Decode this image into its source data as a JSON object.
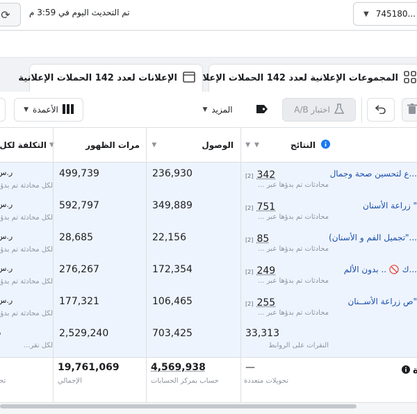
{
  "topbar": {
    "update_text": "تم التحديث اليوم في 3:59 م",
    "account_value": "745180..."
  },
  "tabs": {
    "adsets_label": "المجموعات الإعلانية لعدد 142 الحملات الإعلانية",
    "ads_label": "الإعلانات لعدد 142 الحملات الإعلانية"
  },
  "toolbar": {
    "ab_label": "اختبار A/B",
    "more_label": "المزيد",
    "columns_label": "الأعمدة"
  },
  "table": {
    "headers": {
      "results": "النتائج",
      "reach": "الوصول",
      "impressions": "مرات الظهور",
      "cost": "التكلفة لكل نتيجة"
    },
    "rows": [
      {
        "name": "...ع لتحسين صحة وجمال",
        "results": "342",
        "results_sub": "محادثات تم بدؤها عبر ...",
        "reach": "236,930",
        "impressions": "499,739",
        "cost": "ر.س",
        "cost_sub": "لكل محادثة تم بدؤ..."
      },
      {
        "name": "\" زراعة الأسنان",
        "results": "751",
        "results_sub": "محادثات تم بدؤها عبر ...",
        "reach": "349,889",
        "impressions": "592,797",
        "cost": "ر.س",
        "cost_sub": "لكل محادثة تم بدؤ..."
      },
      {
        "name": "...\"تجميل الفم و الأسنان)",
        "results": "85",
        "results_sub": "محادثات تم بدؤها عبر ...",
        "reach": "22,156",
        "impressions": "28,685",
        "cost": "ر.س",
        "cost_sub": "لكل محادثة تم بدؤ..."
      },
      {
        "name": "...ك 🚫 .. بدون الألم",
        "results": "249",
        "results_sub": "محادثات تم بدؤها عبر ...",
        "reach": "172,354",
        "impressions": "276,267",
        "cost": "ر.س",
        "cost_sub": "لكل محادثة تم بدؤ..."
      },
      {
        "name": "\"ص زراعة الأســنان",
        "results": "255",
        "results_sub": "محادثات تم بدؤها عبر ...",
        "reach": "106,465",
        "impressions": "177,321",
        "cost": "ر.س",
        "cost_sub": "لكل محادثة تم بدؤ..."
      },
      {
        "name": "",
        "results": "33,313",
        "results_sub": "النقرات على الروابط",
        "reach": "703,425",
        "impressions": "2,529,240",
        "cost": "ر",
        "cost_sub": "لكل نقر..."
      }
    ],
    "summary": {
      "label": "ة",
      "results": "—",
      "results_sub": "تحويلات متعددة",
      "reach": "4,569,938",
      "reach_sub": "حساب بمركز الحسابات",
      "impressions": "19,761,069",
      "impressions_sub": "الإجمالي",
      "cost_sub": "تحو"
    }
  },
  "colors": {
    "link": "#1b4fad",
    "row_highlight": "#eef4fd",
    "info_icon": "#1877f2"
  }
}
